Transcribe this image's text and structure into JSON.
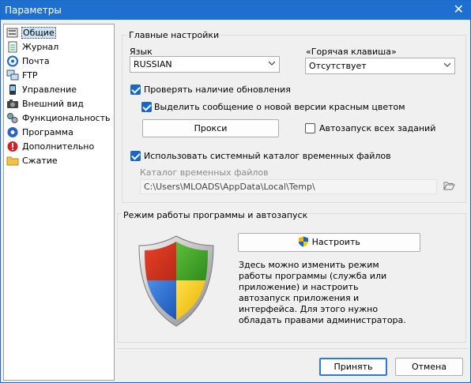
{
  "window": {
    "title": "Параметры",
    "close_glyph": "✕"
  },
  "sidebar": {
    "items": [
      {
        "label": "Общие",
        "icon": "general-icon",
        "selected": true
      },
      {
        "label": "Журнал",
        "icon": "journal-icon"
      },
      {
        "label": "Почта",
        "icon": "mail-icon"
      },
      {
        "label": "FTP",
        "icon": "ftp-icon"
      },
      {
        "label": "Управление",
        "icon": "control-icon"
      },
      {
        "label": "Внешний вид",
        "icon": "appearance-icon"
      },
      {
        "label": "Функциональность",
        "icon": "functionality-icon"
      },
      {
        "label": "Программа",
        "icon": "program-icon"
      },
      {
        "label": "Дополнительно",
        "icon": "advanced-icon"
      },
      {
        "label": "Сжатие",
        "icon": "compression-icon"
      }
    ]
  },
  "main": {
    "group_title": "Главные настройки",
    "language": {
      "label": "Язык",
      "value": "RUSSIAN"
    },
    "hotkey": {
      "label": "«Горячая клавиша»",
      "value": "Отсутствует"
    },
    "check_updates": {
      "label": "Проверять наличие обновления",
      "checked": true
    },
    "highlight_new_version": {
      "label": "Выделить сообщение о новой версии красным цветом",
      "checked": true
    },
    "proxy_button": "Прокси",
    "autostart_all": {
      "label": "Автозапуск всех заданий",
      "checked": false
    },
    "use_system_temp": {
      "label": "Использовать системный каталог временных файлов",
      "checked": true
    },
    "temp_dir": {
      "label": "Каталог временных файлов",
      "value": "C:\\Users\\MLOADS\\AppData\\Local\\Temp\\"
    }
  },
  "mode": {
    "group_title": "Режим работы программы и автозапуск",
    "configure_button": "Настроить",
    "description": "Здесь можно изменить режим работы программы (служба или приложение) и настроить автозапуск приложения и интерфейса. Для этого нужно обладать правами администратора."
  },
  "footer": {
    "ok": "Принять",
    "cancel": "Отмена"
  },
  "colors": {
    "accent": "#1a66c8",
    "titlebar": "#1e6fd0"
  }
}
